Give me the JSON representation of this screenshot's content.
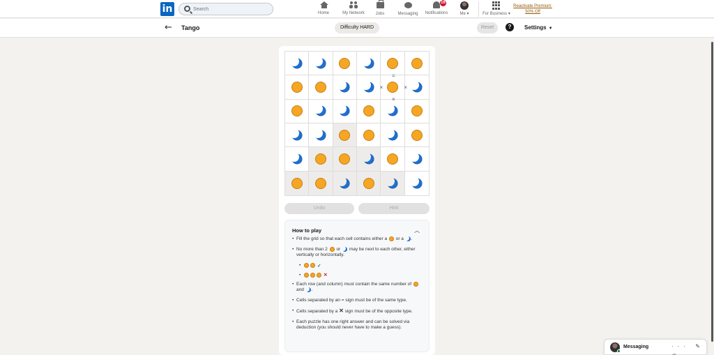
{
  "nav": {
    "search_placeholder": "Search",
    "items": [
      {
        "label": "Home"
      },
      {
        "label": "My Network"
      },
      {
        "label": "Jobs"
      },
      {
        "label": "Messaging"
      },
      {
        "label": "Notifications",
        "badge": "16"
      },
      {
        "label": "Me"
      },
      {
        "label": "For Business"
      }
    ],
    "premium_line1": "Reactivate Premium:",
    "premium_line2": "50% Off"
  },
  "subheader": {
    "title": "Tango",
    "difficulty": "Difficulty HARD",
    "reset": "Reset",
    "help": "?",
    "settings": "Settings"
  },
  "board": {
    "rows": [
      [
        "moon",
        "moon",
        "sun",
        "moon",
        "sun",
        "sun"
      ],
      [
        "sun",
        "sun",
        "moon",
        "moon",
        "sun",
        "moon"
      ],
      [
        "sun",
        "moon",
        "moon",
        "sun",
        "moon",
        "sun"
      ],
      [
        "moon",
        "moon",
        "sun",
        "sun",
        "moon",
        "sun"
      ],
      [
        "moon",
        "sun",
        "sun",
        "moon",
        "sun",
        "moon"
      ],
      [
        "sun",
        "sun",
        "moon",
        "sun",
        "moon",
        "moon"
      ]
    ],
    "prefilled": [
      [
        3,
        2
      ],
      [
        4,
        1
      ],
      [
        4,
        2
      ],
      [
        4,
        3
      ],
      [
        5,
        0
      ],
      [
        5,
        1
      ],
      [
        5,
        2
      ],
      [
        5,
        3
      ],
      [
        5,
        4
      ]
    ],
    "signs": [
      {
        "between": [
          [
            0,
            4
          ],
          [
            1,
            4
          ]
        ],
        "symbol": "="
      },
      {
        "between": [
          [
            1,
            3
          ],
          [
            1,
            4
          ]
        ],
        "symbol": "×"
      },
      {
        "between": [
          [
            1,
            4
          ],
          [
            1,
            5
          ]
        ],
        "symbol": "×"
      },
      {
        "between": [
          [
            1,
            4
          ],
          [
            2,
            4
          ]
        ],
        "symbol": "×"
      }
    ]
  },
  "controls": {
    "undo": "Undo",
    "hint": "Hint"
  },
  "how_to_play": {
    "title": "How to play",
    "rule1_a": "Fill the grid so that each cell contains either a",
    "rule1_b": "or a",
    "rule1_c": ".",
    "rule2_a": "No more than 2",
    "rule2_b": "or",
    "rule2_c": "may be next to each other, either vertically or horizontally.",
    "ok_mark": "✓",
    "bad_mark": "✕",
    "rule3_a": "Each row (and column) must contain the same number of",
    "rule3_b": "and",
    "rule3_c": ".",
    "rule4": "Cells separated by an = sign must be of the same type.",
    "rule5_a": "Cells separated by a",
    "rule5_x": "✕",
    "rule5_b": "sign must be of the opposite type.",
    "rule6": "Each puzzle has one right answer and can be solved via deduction (you should never have to make a guess)."
  },
  "messaging": {
    "label": "Messaging",
    "actions": "··· ✎ ︿"
  }
}
